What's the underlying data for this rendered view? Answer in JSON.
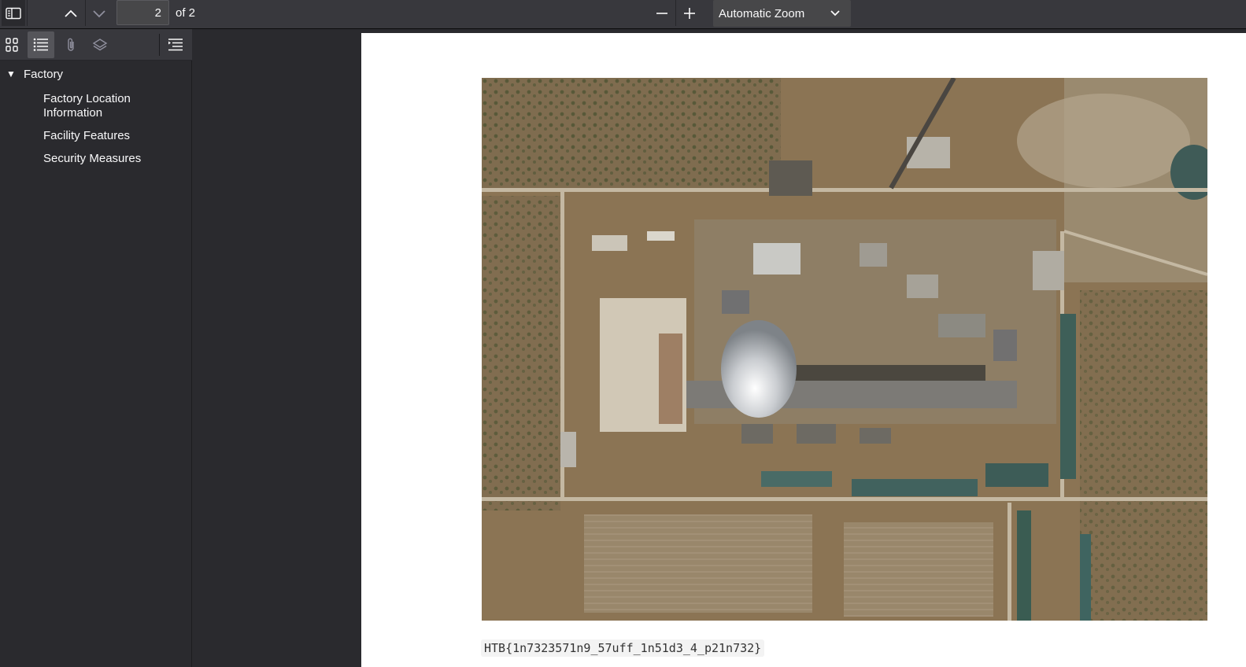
{
  "toolbar": {
    "page_number": "2",
    "page_count": "of 2",
    "zoom_value": "Automatic Zoom",
    "icons": {
      "sidebar_toggle": "sidebar-toggle-icon",
      "previous": "chevron-up-icon",
      "next": "chevron-down-icon",
      "zoom_out": "minus-icon",
      "zoom_in": "plus-icon",
      "zoom_dropdown": "chevron-down-icon"
    }
  },
  "sidebar": {
    "tabs": [
      {
        "name": "thumbnails",
        "icon": "grid-icon",
        "active": false
      },
      {
        "name": "document-outline",
        "icon": "list-icon",
        "active": true
      },
      {
        "name": "attachments",
        "icon": "paperclip-icon",
        "active": false
      },
      {
        "name": "layers",
        "icon": "layers-icon",
        "active": false
      },
      {
        "name": "current-outline-item",
        "icon": "outline-current-icon",
        "active": false
      }
    ],
    "outline": {
      "root": "Factory",
      "children": [
        "Factory Location Information",
        "Facility Features",
        "Security Measures"
      ]
    }
  },
  "document": {
    "image_description": "satellite-image-of-industrial-facility",
    "flag_text": "HTB{1n7323571n9_57uff_1n51d3_4_p21n732}"
  },
  "colors": {
    "toolbar_bg": "#38383d",
    "sidebar_bg": "#2a2a2e",
    "page_bg": "#ffffff",
    "code_bg": "#f3f3f3"
  }
}
